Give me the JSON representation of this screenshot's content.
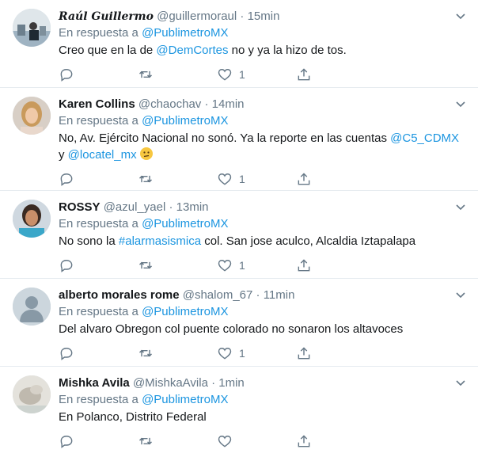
{
  "tweets": [
    {
      "name": "Raúl Guillermo",
      "handle": "@guillermoraul",
      "time": "15min",
      "reply_prefix": "En respuesta a",
      "reply_to": "@PublimetroMX",
      "text_parts": [
        "Creo que en la de ",
        "@DemCortes",
        " no y ya la hizo de tos."
      ],
      "likes": "1"
    },
    {
      "name": "Karen Collins",
      "handle": "@chaochav",
      "time": "14min",
      "reply_prefix": "En respuesta a",
      "reply_to": "@PublimetroMX",
      "text_parts": [
        "No, Av. Ejército Nacional no sonó. Ya la reporte en las cuentas ",
        "@C5_CDMX",
        " y ",
        "@locatel_mx"
      ],
      "emoji": "confused-face",
      "likes": "1"
    },
    {
      "name": "ROSSY",
      "handle": "@azul_yael",
      "time": "13min",
      "reply_prefix": "En respuesta a",
      "reply_to": "@PublimetroMX",
      "text_parts": [
        "No sono la ",
        "#alarmasismica",
        " col. San jose aculco, Alcaldia Iztapalapa"
      ],
      "likes": "1"
    },
    {
      "name": "alberto morales rome",
      "handle": "@shalom_67",
      "time": "11min",
      "reply_prefix": "En respuesta a",
      "reply_to": "@PublimetroMX",
      "text": "Del alvaro Obregon col puente colorado no sonaron los altavoces",
      "likes": "1"
    },
    {
      "name": "Mishka Avila",
      "handle": "@MishkaAvila",
      "time": "1min",
      "reply_prefix": "En respuesta a",
      "reply_to": "@PublimetroMX",
      "text": "En Polanco, Distrito Federal",
      "likes": ""
    }
  ],
  "separator": " · ",
  "colors": {
    "link": "#1b95e0",
    "muted": "#657786",
    "border": "#e6ecf0"
  }
}
